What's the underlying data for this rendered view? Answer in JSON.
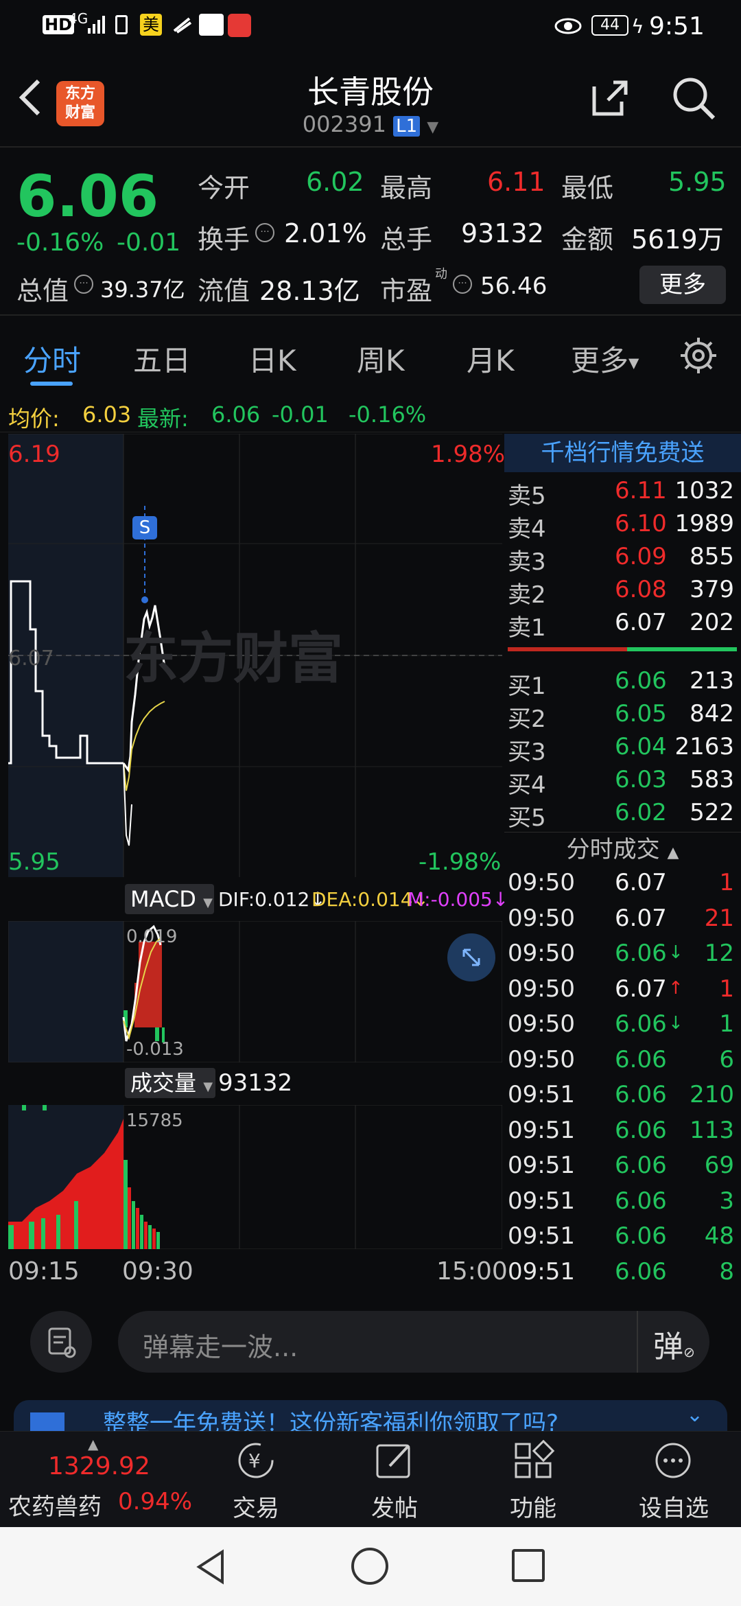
{
  "status": {
    "indicators": "HD 4G",
    "battery": "44",
    "time": "9:51",
    "app_badge": "美"
  },
  "header": {
    "title": "长青股份",
    "code": "002391",
    "level": "L1",
    "logo_line1": "东方",
    "logo_line2": "财富"
  },
  "quote": {
    "price": "6.06",
    "pct": "-0.16%",
    "chg": "-0.01",
    "row1": [
      {
        "label": "今开",
        "value": "6.02",
        "color": "green"
      },
      {
        "label": "最高",
        "value": "6.11",
        "color": "red"
      },
      {
        "label": "最低",
        "value": "5.95",
        "color": "green"
      }
    ],
    "row2": [
      {
        "label": "换手",
        "value": "2.01%"
      },
      {
        "label": "总手",
        "value": "93132"
      },
      {
        "label": "金额",
        "value": "5619万"
      }
    ],
    "row3": [
      {
        "label": "总值",
        "value": "39.37亿"
      },
      {
        "label": "流值",
        "value": "28.13亿"
      },
      {
        "label": "市盈",
        "sup": "动",
        "value": "56.46"
      }
    ],
    "more_btn": "更多"
  },
  "tabs": [
    "分时",
    "五日",
    "日K",
    "周K",
    "月K",
    "更多"
  ],
  "info": {
    "avg_label": "均价:",
    "avg": "6.03",
    "latest_label": "最新:",
    "latest": "6.06",
    "chg": "-0.01",
    "pct": "-0.16%"
  },
  "chart": {
    "top_price": "6.19",
    "top_pct": "1.98%",
    "mid_price": "6.07",
    "bottom_price": "5.95",
    "bottom_pct": "-1.98%",
    "marker": "S",
    "watermark": "东方财富",
    "macd": {
      "name": "MACD",
      "dif": "DIF:0.012↓",
      "dea": "DEA:0.014↓",
      "m": "M:-0.005↓",
      "hi": "0.019",
      "lo": "-0.013"
    },
    "volume": {
      "name": "成交量",
      "total": "93132",
      "max": "15785"
    },
    "times": [
      "09:15",
      "09:30",
      "15:00"
    ]
  },
  "orderbook": {
    "promo": "千档行情免费送",
    "asks": [
      {
        "l": "卖5",
        "p": "6.11",
        "v": "1032",
        "c": "red"
      },
      {
        "l": "卖4",
        "p": "6.10",
        "v": "1989",
        "c": "red"
      },
      {
        "l": "卖3",
        "p": "6.09",
        "v": "855",
        "c": "red"
      },
      {
        "l": "卖2",
        "p": "6.08",
        "v": "379",
        "c": "red"
      },
      {
        "l": "卖1",
        "p": "6.07",
        "v": "202",
        "c": "white"
      }
    ],
    "bids": [
      {
        "l": "买1",
        "p": "6.06",
        "v": "213"
      },
      {
        "l": "买2",
        "p": "6.05",
        "v": "842"
      },
      {
        "l": "买3",
        "p": "6.04",
        "v": "2163"
      },
      {
        "l": "买4",
        "p": "6.03",
        "v": "583"
      },
      {
        "l": "买5",
        "p": "6.02",
        "v": "522"
      }
    ]
  },
  "ticks": {
    "title": "分时成交",
    "rows": [
      {
        "t": "09:50",
        "p": "6.07",
        "pc": "white",
        "a": "",
        "v": "1",
        "vc": "red"
      },
      {
        "t": "09:50",
        "p": "6.07",
        "pc": "white",
        "a": "",
        "v": "21",
        "vc": "red"
      },
      {
        "t": "09:50",
        "p": "6.06",
        "pc": "green",
        "a": "↓",
        "v": "12",
        "vc": "green"
      },
      {
        "t": "09:50",
        "p": "6.07",
        "pc": "white",
        "a": "↑",
        "v": "1",
        "vc": "red"
      },
      {
        "t": "09:50",
        "p": "6.06",
        "pc": "green",
        "a": "↓",
        "v": "1",
        "vc": "green"
      },
      {
        "t": "09:50",
        "p": "6.06",
        "pc": "green",
        "a": "",
        "v": "6",
        "vc": "green"
      },
      {
        "t": "09:51",
        "p": "6.06",
        "pc": "green",
        "a": "",
        "v": "210",
        "vc": "green"
      },
      {
        "t": "09:51",
        "p": "6.06",
        "pc": "green",
        "a": "",
        "v": "113",
        "vc": "green"
      },
      {
        "t": "09:51",
        "p": "6.06",
        "pc": "green",
        "a": "",
        "v": "69",
        "vc": "green"
      },
      {
        "t": "09:51",
        "p": "6.06",
        "pc": "green",
        "a": "",
        "v": "3",
        "vc": "green"
      },
      {
        "t": "09:51",
        "p": "6.06",
        "pc": "green",
        "a": "",
        "v": "48",
        "vc": "green"
      },
      {
        "t": "09:51",
        "p": "6.06",
        "pc": "green",
        "a": "",
        "v": "8",
        "vc": "green"
      }
    ]
  },
  "comment": {
    "placeholder": "弹幕走一波...",
    "danmu": "弹"
  },
  "banner": {
    "text": "整整一年免费送！这份新客福利你领取了吗?"
  },
  "bottom": {
    "index_value": "1329.92",
    "index_name": "农药兽药",
    "index_pct": "0.94%",
    "items": [
      "交易",
      "发帖",
      "功能",
      "设自选"
    ]
  }
}
